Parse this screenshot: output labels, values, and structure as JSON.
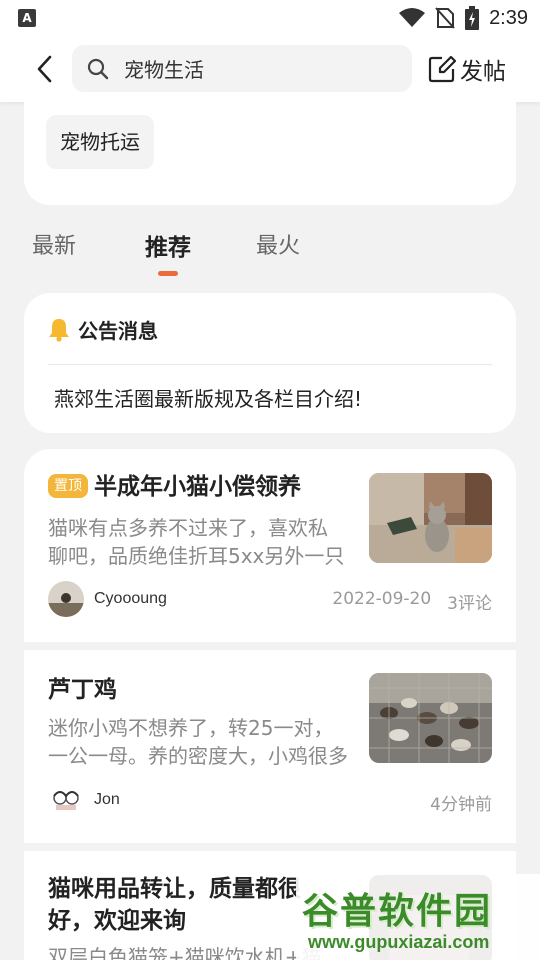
{
  "status_bar": {
    "time": "2:39"
  },
  "header": {
    "search_value": "宠物生活",
    "post_label": "发帖"
  },
  "category_chip": "宠物托运",
  "tabs": [
    {
      "label": "最新",
      "active": false
    },
    {
      "label": "推荐",
      "active": true
    },
    {
      "label": "最火",
      "active": false
    }
  ],
  "notice": {
    "title": "公告消息",
    "message": "燕郊生活圈最新版规及各栏目介绍!"
  },
  "posts": [
    {
      "pinned_label": "置顶",
      "title": "半成年小猫小偿领养",
      "desc_line1": "猫咪有点多养不过来了，喜欢私",
      "desc_line2": "聊吧，品质绝佳折耳5xx另外一只",
      "author": "Cyoooung",
      "date": "2022-09-20",
      "comments": "3评论"
    },
    {
      "title": "芦丁鸡",
      "desc_line1": "迷你小鸡不想养了，转25一对，",
      "desc_line2": "一公一母。养的密度大，小鸡很多",
      "author": "Jon",
      "time": "4分钟前"
    },
    {
      "title_line1": "猫咪用品转让，质量都很",
      "title_line2": "好，欢迎来询",
      "desc_line1": "双层白色猫笼+猫咪饮水机+猫"
    }
  ],
  "watermark": {
    "big": "谷普软件园",
    "small": "www.gupuxiazai.com"
  },
  "colors": {
    "accent": "#ec6b3c",
    "pin_badge": "#f3b63a",
    "bell": "#f5b82e",
    "watermark_green": "#3c8b2a"
  }
}
